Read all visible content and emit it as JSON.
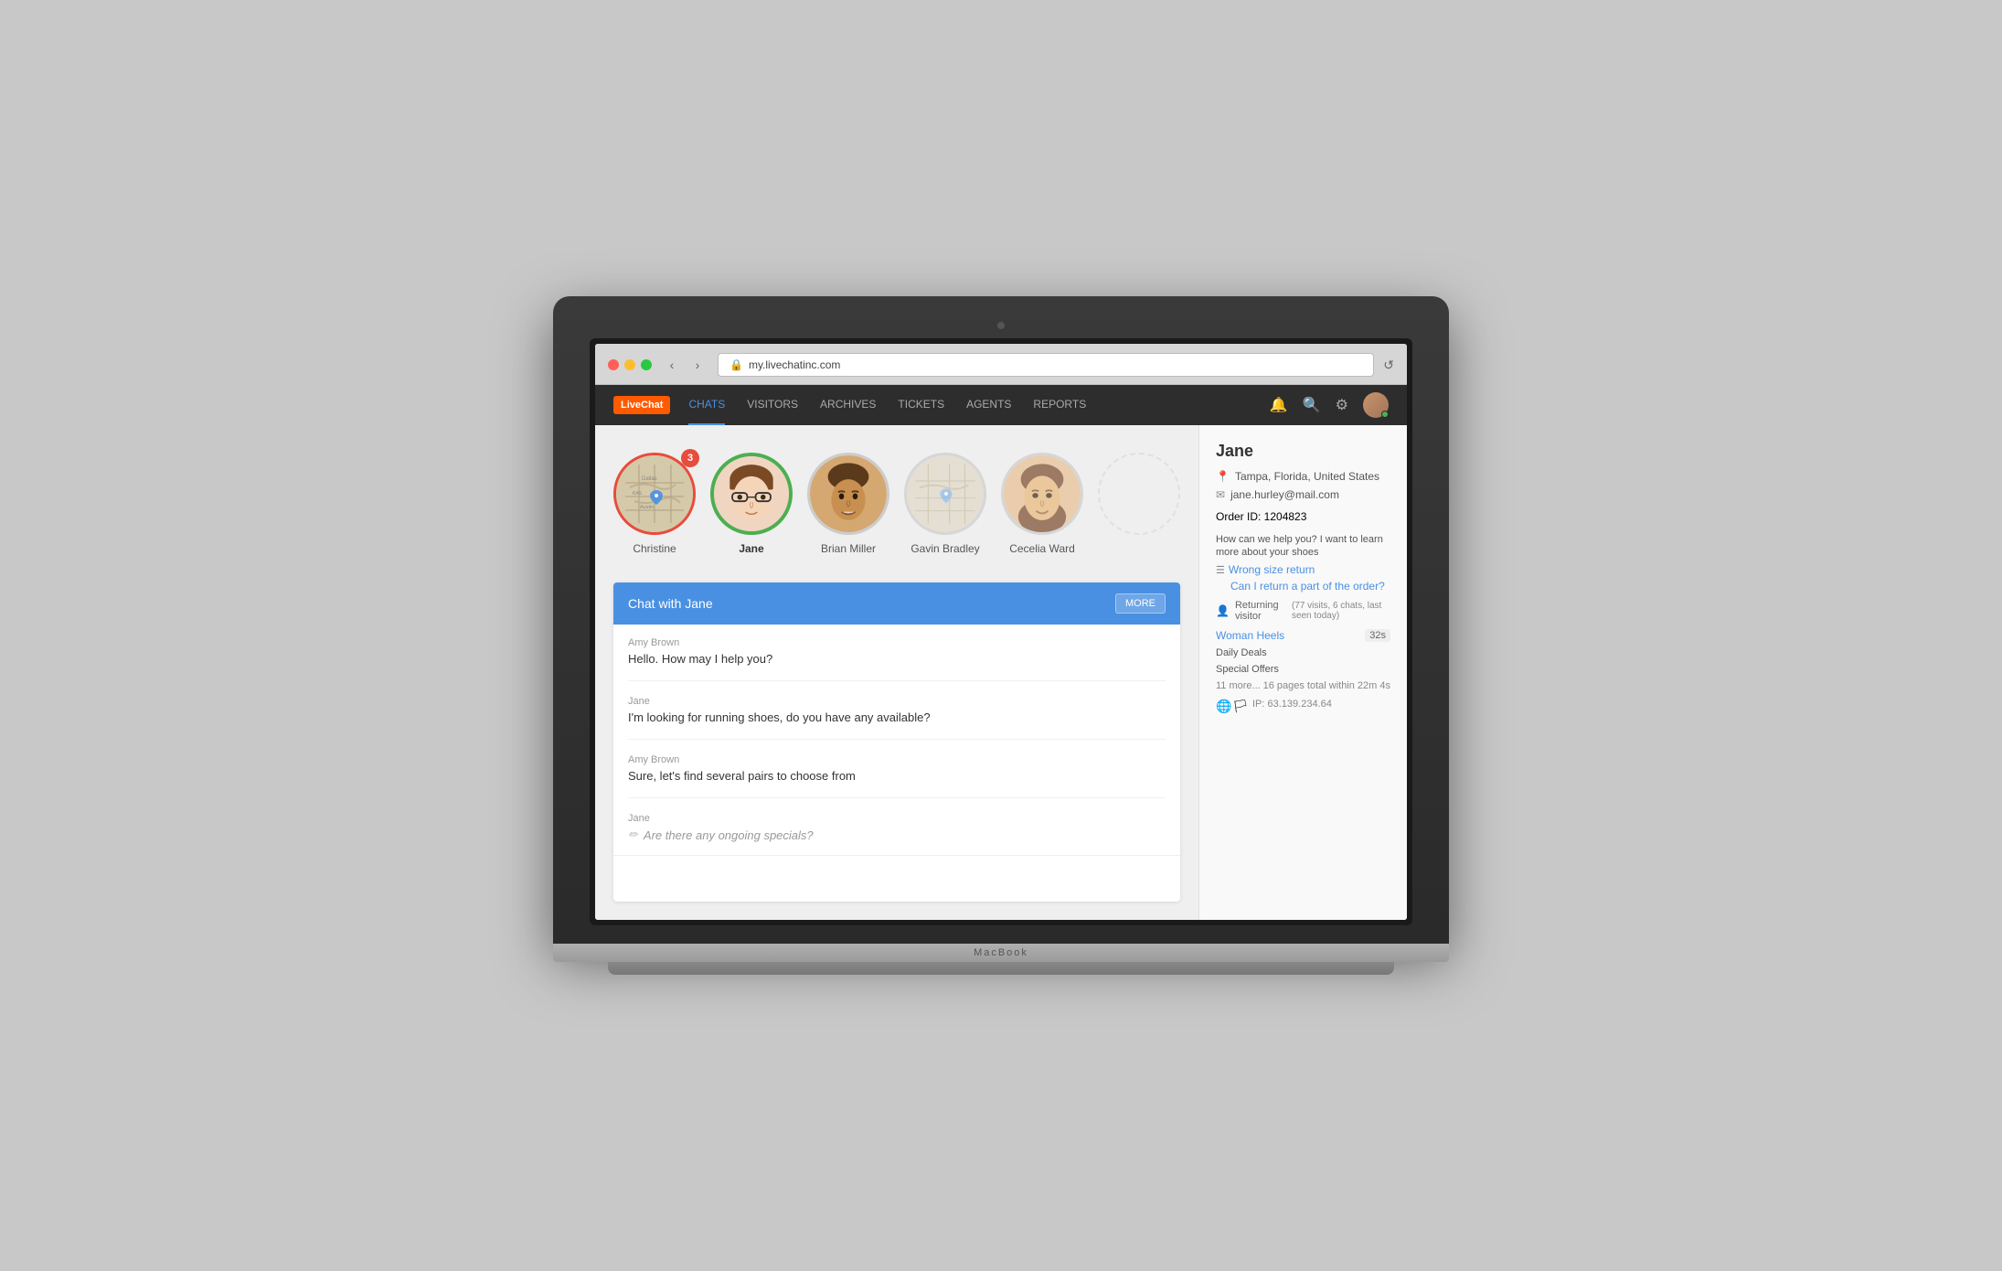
{
  "browser": {
    "url": "my.livechatinc.com",
    "lock_icon": "🔒",
    "reload_icon": "↺"
  },
  "navbar": {
    "logo": "LiveChat",
    "items": [
      {
        "id": "chats",
        "label": "CHATS",
        "active": true
      },
      {
        "id": "visitors",
        "label": "VISITORS",
        "active": false
      },
      {
        "id": "archives",
        "label": "ARCHIVES",
        "active": false
      },
      {
        "id": "tickets",
        "label": "TICKETS",
        "active": false
      },
      {
        "id": "agents",
        "label": "AGENTS",
        "active": false
      },
      {
        "id": "reports",
        "label": "REPORTS",
        "active": false
      }
    ]
  },
  "visitors": [
    {
      "id": "christine",
      "name": "Christine",
      "type": "map",
      "badge": 3,
      "bold": false
    },
    {
      "id": "jane",
      "name": "Jane",
      "type": "person",
      "badge": null,
      "bold": true
    },
    {
      "id": "brian",
      "name": "Brian Miller",
      "type": "person",
      "badge": null,
      "bold": false
    },
    {
      "id": "gavin",
      "name": "Gavin Bradley",
      "type": "map2",
      "badge": null,
      "bold": false
    },
    {
      "id": "cecelia",
      "name": "Cecelia Ward",
      "type": "person2",
      "badge": null,
      "bold": false
    },
    {
      "id": "unknown",
      "name": "",
      "type": "empty",
      "badge": null,
      "bold": false
    }
  ],
  "chat": {
    "title": "Chat with Jane",
    "more_btn": "MORE",
    "messages": [
      {
        "sender": "Amy Brown",
        "text": "Hello. How may I help you?",
        "typing": false
      },
      {
        "sender": "Jane",
        "text": "I'm looking for running shoes, do you have any available?",
        "typing": false
      },
      {
        "sender": "Amy Brown",
        "text": "Sure, let's find several pairs to choose from",
        "typing": false
      },
      {
        "sender": "Jane",
        "text": "Are there any ongoing specials?",
        "typing": true
      }
    ],
    "input_placeholder": ""
  },
  "sidebar": {
    "name": "Jane",
    "location": "Tampa, Florida, United States",
    "email": "jane.hurley@mail.com",
    "order_id_label": "Order ID: 1204823",
    "question": "How can we help you? I want to learn more about your shoes",
    "links": [
      "Wrong size return",
      "Can I return a part of the order?"
    ],
    "visitor_info": "Returning visitor",
    "visits": "(77 visits, 6 chats, last seen today)",
    "pages": [
      {
        "label": "Woman Heels",
        "time": "32s"
      },
      {
        "label": "Daily Deals",
        "time": null
      },
      {
        "label": "Special Offers",
        "time": null
      }
    ],
    "more_pages": "11 more...",
    "total_pages": "16 pages total within 22m 4s",
    "ip": "IP: 63.139.234.64"
  }
}
